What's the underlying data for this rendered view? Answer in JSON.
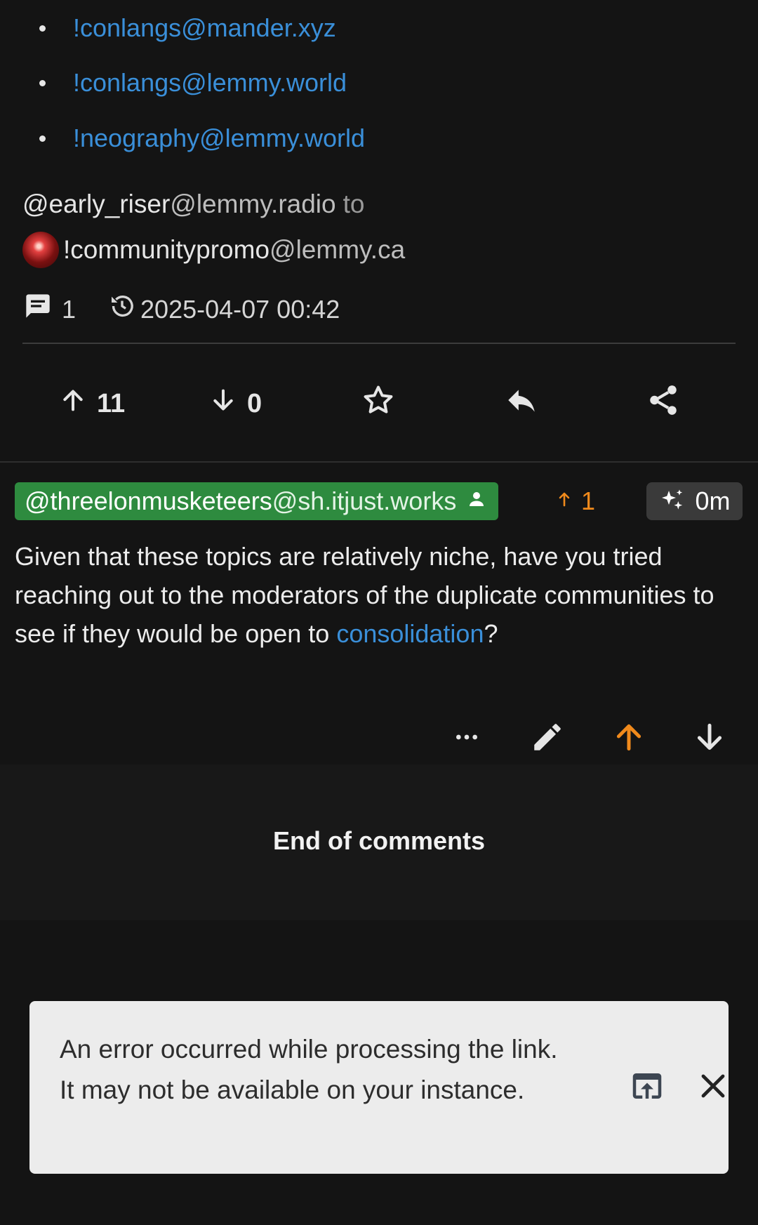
{
  "post": {
    "crosspost_links": [
      "!conlangs@mander.xyz",
      "!conlangs@lemmy.world",
      "!neography@lemmy.world"
    ],
    "author": {
      "name": "@early_riser",
      "instance": "@lemmy.radio",
      "to_label": "to"
    },
    "community": {
      "name": "!communitypromo",
      "instance": "@lemmy.ca"
    },
    "comment_count": "1",
    "timestamp": "2025-04-07 00:42",
    "upvotes": "11",
    "downvotes": "0",
    "icons": {
      "comments": "comment-icon",
      "history": "history-icon",
      "upvote": "arrow-up-icon",
      "downvote": "arrow-down-icon",
      "save": "star-icon",
      "reply": "reply-icon",
      "share": "share-icon"
    }
  },
  "comment": {
    "user_name": "@threelonmusketeers",
    "user_instance": "@sh.itjust.works",
    "score": "1",
    "age": "0m",
    "body_text": "Given that these topics are relatively niche, have you tried reaching out to the moderators of the duplicate communities to see if they would be open to",
    "body_link": "consolidation",
    "body_tail": "?",
    "colors": {
      "user_chip": "#2e8b3f",
      "score_orange": "#f08a1c",
      "link_blue": "#3a8fd9"
    },
    "icons": {
      "person": "person-icon",
      "new": "sparkle-icon",
      "more": "more-icon",
      "edit": "pencil-icon",
      "upvote": "arrow-up-icon",
      "downvote": "arrow-down-icon"
    }
  },
  "end_of_comments": "End of comments",
  "snackbar": {
    "message": "An error occurred while processing the link. It may not be available on your instance.",
    "icons": {
      "open": "open-in-browser-icon",
      "close": "close-icon"
    }
  }
}
